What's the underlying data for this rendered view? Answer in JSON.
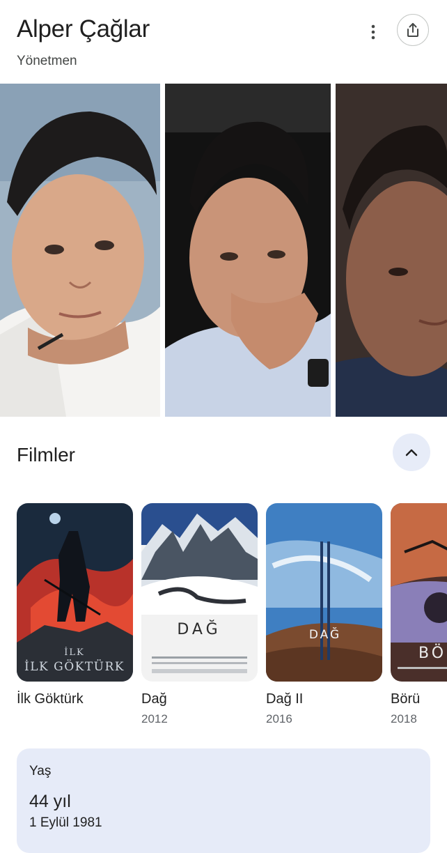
{
  "header": {
    "title": "Alper Çağlar",
    "subtitle": "Yönetmen",
    "more_icon": "more-vert-icon",
    "share_icon": "share-icon"
  },
  "photos": [
    {
      "name": "person-photo-1"
    },
    {
      "name": "person-photo-2"
    },
    {
      "name": "person-photo-3"
    }
  ],
  "films_section": {
    "title": "Filmler",
    "collapse_icon": "chevron-up-icon",
    "items": [
      {
        "title": "İlk Göktürk",
        "year": "",
        "poster_text": "İLK GÖKTÜRK"
      },
      {
        "title": "Dağ",
        "year": "2012",
        "poster_text": "DAĞ"
      },
      {
        "title": "Dağ II",
        "year": "2016",
        "poster_text": "DAĞ"
      },
      {
        "title": "Börü",
        "year": "2018",
        "poster_text": "BÖ"
      }
    ]
  },
  "age_card": {
    "label": "Yaş",
    "value": "44 yıl",
    "birth_date": "1 Eylül 1981"
  },
  "colors": {
    "accent_bg": "#e7ecf8",
    "card_bg": "#e6ebf8",
    "text_primary": "#1f1f1f",
    "text_secondary": "#5f6368"
  }
}
